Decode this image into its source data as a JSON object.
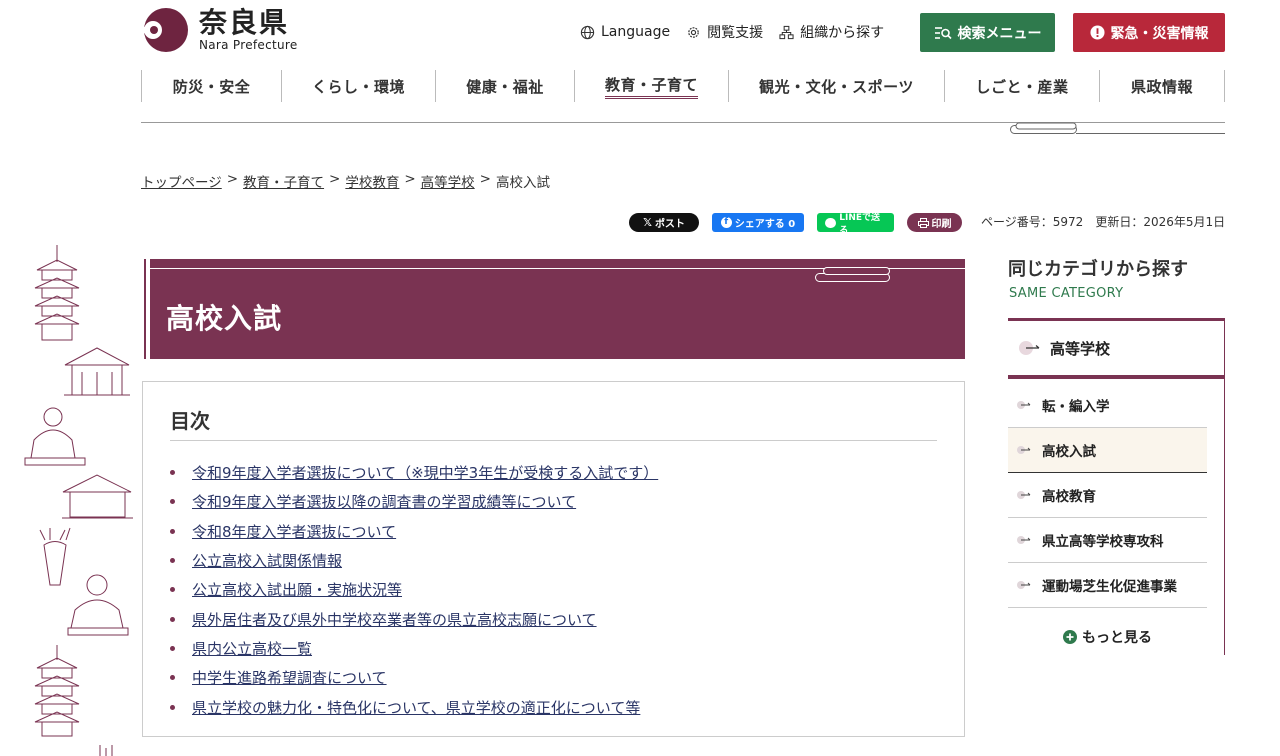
{
  "header": {
    "logo_title": "奈良県",
    "logo_sub": "Nara Prefecture",
    "util_links": [
      "Language",
      "閲覧支援",
      "組織から探す"
    ],
    "search_menu_label": "検索メニュー",
    "emergency_label": "緊急・災害情報"
  },
  "gnav": [
    "防災・安全",
    "くらし・環境",
    "健康・福祉",
    "教育・子育て",
    "観光・文化・スポーツ",
    "しごと・産業",
    "県政情報"
  ],
  "breadcrumb": {
    "links": [
      "トップページ",
      "教育・子育て",
      "学校教育",
      "高等学校"
    ],
    "separator": ">",
    "current": "高校入試"
  },
  "share": {
    "x_label": "ポスト",
    "fb_label": "シェアする 0",
    "line_label": "LINEで送る",
    "print_label": "印刷"
  },
  "meta": {
    "page_number": "ページ番号：5972",
    "updated": "更新日：2026年5月1日"
  },
  "main": {
    "title": "高校入試",
    "toc_title": "目次",
    "toc_items": [
      "令和9年度入学者選抜について（※現中学3年生が受検する入試です）",
      "令和9年度入学者選抜以降の調査書の学習成績等について",
      "令和8年度入学者選抜について",
      "公立高校入試関係情報",
      "公立高校入試出願・実施状況等",
      "県外居住者及び県外中学校卒業者等の県立高校志願について",
      "県内公立高校一覧",
      "中学生進路希望調査について",
      "県立学校の魅力化・特色化について、県立学校の適正化について等"
    ]
  },
  "sidebar": {
    "heading": "同じカテゴリから探す",
    "sub": "SAME CATEGORY",
    "parent": "高等学校",
    "items": [
      "転・編入学",
      "高校入試",
      "高校教育",
      "県立高等学校専攻科",
      "運動場芝生化促進事業"
    ],
    "current_index": 1,
    "more": "もっと見る"
  },
  "colors": {
    "brand": "#7a3352",
    "green": "#2f7a4d",
    "red": "#b8283a"
  }
}
